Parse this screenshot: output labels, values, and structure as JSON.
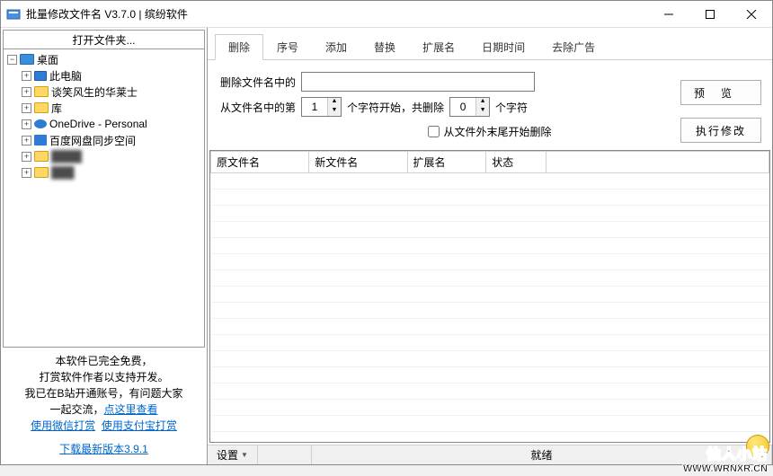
{
  "titlebar": {
    "title": "批量修改文件名 V3.7.0 | 缤纷软件"
  },
  "leftPanel": {
    "header": "打开文件夹...",
    "tree": {
      "root": "桌面",
      "items": [
        {
          "label": "此电脑",
          "iconType": "monitor"
        },
        {
          "label": "谈笑风生的华莱士",
          "iconType": "yellow"
        },
        {
          "label": "库",
          "iconType": "yellow"
        },
        {
          "label": "OneDrive - Personal",
          "iconType": "cloud"
        },
        {
          "label": "百度网盘同步空间",
          "iconType": "baidu"
        },
        {
          "label": "████",
          "iconType": "yellow",
          "blurred": true
        },
        {
          "label": "███",
          "iconType": "yellow",
          "blurred": true
        }
      ]
    },
    "footer": {
      "line1": "本软件已完全免费，",
      "line2": "打赏软件作者以支持开发。",
      "line3_a": "我已在B站开通账号，有问题大家",
      "line3_b": "一起交流，",
      "link_view": "点这里查看",
      "link_wechat": "使用微信打赏",
      "link_alipay": "使用支付宝打赏",
      "link_download": "下载最新版本3.9.1"
    }
  },
  "tabs": [
    "删除",
    "序号",
    "添加",
    "替换",
    "扩展名",
    "日期时间",
    "去除广告"
  ],
  "activeTab": 0,
  "deleteForm": {
    "label1": "删除文件名中的",
    "input1_value": "",
    "label2_a": "从文件名中的第",
    "spin1": "1",
    "label2_b": "个字符开始，共删除",
    "spin2": "0",
    "label2_c": "个字符",
    "checkbox_label": "从文件外末尾开始删除",
    "checkbox_checked": false
  },
  "buttons": {
    "preview": "预览",
    "execute": "执行修改"
  },
  "grid": {
    "columns": [
      "原文件名",
      "新文件名",
      "扩展名",
      "状态"
    ]
  },
  "statusbar": {
    "settings": "设置",
    "status": "就绪"
  },
  "watermark": {
    "line1": "仙人小站",
    "line2": "WWW.WRNXR.CN"
  }
}
